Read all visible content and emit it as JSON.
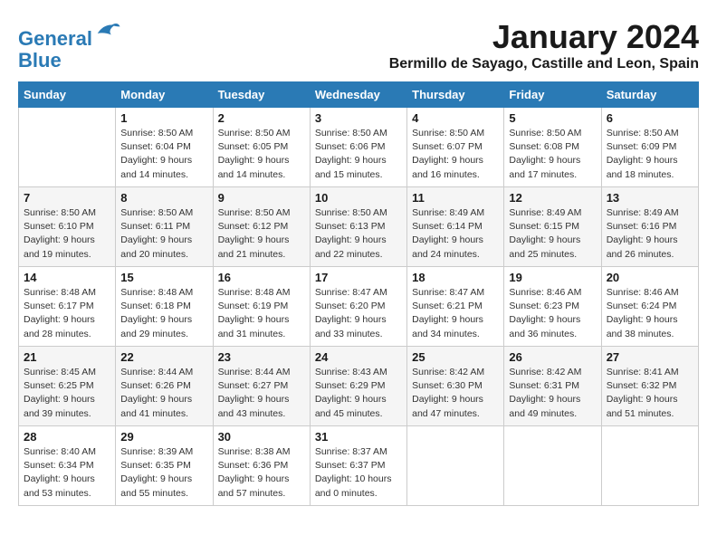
{
  "header": {
    "logo_line1": "General",
    "logo_line2": "Blue",
    "month_title": "January 2024",
    "location": "Bermillo de Sayago, Castille and Leon, Spain"
  },
  "weekdays": [
    "Sunday",
    "Monday",
    "Tuesday",
    "Wednesday",
    "Thursday",
    "Friday",
    "Saturday"
  ],
  "weeks": [
    [
      {
        "day": "",
        "info": ""
      },
      {
        "day": "1",
        "info": "Sunrise: 8:50 AM\nSunset: 6:04 PM\nDaylight: 9 hours\nand 14 minutes."
      },
      {
        "day": "2",
        "info": "Sunrise: 8:50 AM\nSunset: 6:05 PM\nDaylight: 9 hours\nand 14 minutes."
      },
      {
        "day": "3",
        "info": "Sunrise: 8:50 AM\nSunset: 6:06 PM\nDaylight: 9 hours\nand 15 minutes."
      },
      {
        "day": "4",
        "info": "Sunrise: 8:50 AM\nSunset: 6:07 PM\nDaylight: 9 hours\nand 16 minutes."
      },
      {
        "day": "5",
        "info": "Sunrise: 8:50 AM\nSunset: 6:08 PM\nDaylight: 9 hours\nand 17 minutes."
      },
      {
        "day": "6",
        "info": "Sunrise: 8:50 AM\nSunset: 6:09 PM\nDaylight: 9 hours\nand 18 minutes."
      }
    ],
    [
      {
        "day": "7",
        "info": "Sunrise: 8:50 AM\nSunset: 6:10 PM\nDaylight: 9 hours\nand 19 minutes."
      },
      {
        "day": "8",
        "info": "Sunrise: 8:50 AM\nSunset: 6:11 PM\nDaylight: 9 hours\nand 20 minutes."
      },
      {
        "day": "9",
        "info": "Sunrise: 8:50 AM\nSunset: 6:12 PM\nDaylight: 9 hours\nand 21 minutes."
      },
      {
        "day": "10",
        "info": "Sunrise: 8:50 AM\nSunset: 6:13 PM\nDaylight: 9 hours\nand 22 minutes."
      },
      {
        "day": "11",
        "info": "Sunrise: 8:49 AM\nSunset: 6:14 PM\nDaylight: 9 hours\nand 24 minutes."
      },
      {
        "day": "12",
        "info": "Sunrise: 8:49 AM\nSunset: 6:15 PM\nDaylight: 9 hours\nand 25 minutes."
      },
      {
        "day": "13",
        "info": "Sunrise: 8:49 AM\nSunset: 6:16 PM\nDaylight: 9 hours\nand 26 minutes."
      }
    ],
    [
      {
        "day": "14",
        "info": "Sunrise: 8:48 AM\nSunset: 6:17 PM\nDaylight: 9 hours\nand 28 minutes."
      },
      {
        "day": "15",
        "info": "Sunrise: 8:48 AM\nSunset: 6:18 PM\nDaylight: 9 hours\nand 29 minutes."
      },
      {
        "day": "16",
        "info": "Sunrise: 8:48 AM\nSunset: 6:19 PM\nDaylight: 9 hours\nand 31 minutes."
      },
      {
        "day": "17",
        "info": "Sunrise: 8:47 AM\nSunset: 6:20 PM\nDaylight: 9 hours\nand 33 minutes."
      },
      {
        "day": "18",
        "info": "Sunrise: 8:47 AM\nSunset: 6:21 PM\nDaylight: 9 hours\nand 34 minutes."
      },
      {
        "day": "19",
        "info": "Sunrise: 8:46 AM\nSunset: 6:23 PM\nDaylight: 9 hours\nand 36 minutes."
      },
      {
        "day": "20",
        "info": "Sunrise: 8:46 AM\nSunset: 6:24 PM\nDaylight: 9 hours\nand 38 minutes."
      }
    ],
    [
      {
        "day": "21",
        "info": "Sunrise: 8:45 AM\nSunset: 6:25 PM\nDaylight: 9 hours\nand 39 minutes."
      },
      {
        "day": "22",
        "info": "Sunrise: 8:44 AM\nSunset: 6:26 PM\nDaylight: 9 hours\nand 41 minutes."
      },
      {
        "day": "23",
        "info": "Sunrise: 8:44 AM\nSunset: 6:27 PM\nDaylight: 9 hours\nand 43 minutes."
      },
      {
        "day": "24",
        "info": "Sunrise: 8:43 AM\nSunset: 6:29 PM\nDaylight: 9 hours\nand 45 minutes."
      },
      {
        "day": "25",
        "info": "Sunrise: 8:42 AM\nSunset: 6:30 PM\nDaylight: 9 hours\nand 47 minutes."
      },
      {
        "day": "26",
        "info": "Sunrise: 8:42 AM\nSunset: 6:31 PM\nDaylight: 9 hours\nand 49 minutes."
      },
      {
        "day": "27",
        "info": "Sunrise: 8:41 AM\nSunset: 6:32 PM\nDaylight: 9 hours\nand 51 minutes."
      }
    ],
    [
      {
        "day": "28",
        "info": "Sunrise: 8:40 AM\nSunset: 6:34 PM\nDaylight: 9 hours\nand 53 minutes."
      },
      {
        "day": "29",
        "info": "Sunrise: 8:39 AM\nSunset: 6:35 PM\nDaylight: 9 hours\nand 55 minutes."
      },
      {
        "day": "30",
        "info": "Sunrise: 8:38 AM\nSunset: 6:36 PM\nDaylight: 9 hours\nand 57 minutes."
      },
      {
        "day": "31",
        "info": "Sunrise: 8:37 AM\nSunset: 6:37 PM\nDaylight: 10 hours\nand 0 minutes."
      },
      {
        "day": "",
        "info": ""
      },
      {
        "day": "",
        "info": ""
      },
      {
        "day": "",
        "info": ""
      }
    ]
  ]
}
